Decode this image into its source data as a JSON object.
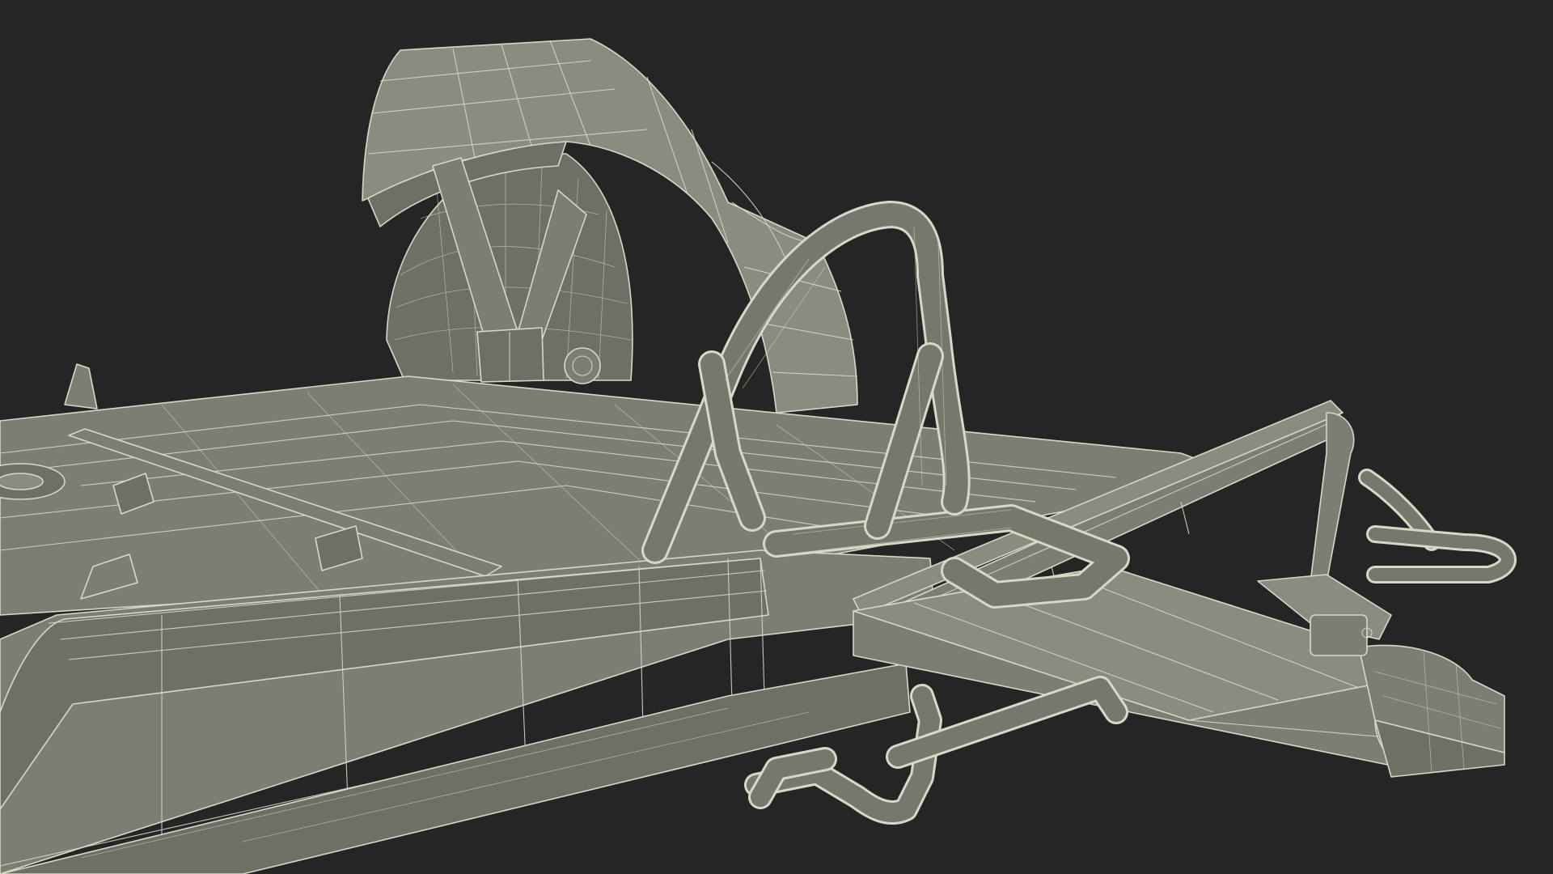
{
  "scene": {
    "subject": "",
    "render_style": "wireframe-over-clay",
    "colors": {
      "background": "#252525",
      "surface": "#7d7d73",
      "surface_dark": "#6f6f66",
      "wireframe": "#d8d8c6"
    }
  }
}
